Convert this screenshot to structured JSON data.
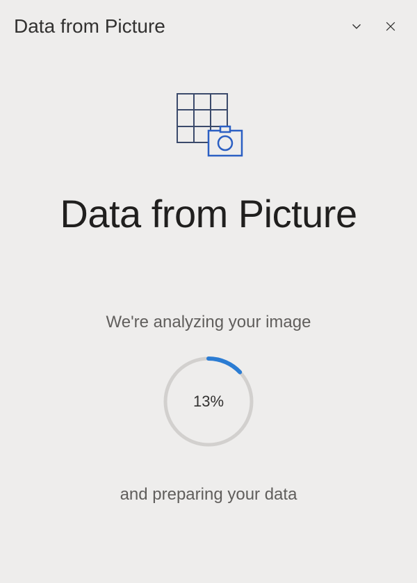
{
  "header": {
    "title": "Data from Picture"
  },
  "main": {
    "heading": "Data from Picture",
    "status_top": "We're analyzing your image",
    "status_bottom": "and preparing your data",
    "progress_percent": 13,
    "progress_label": "13%"
  },
  "colors": {
    "accent": "#2b7cd3",
    "icon_stroke": "#3b4a6b"
  }
}
